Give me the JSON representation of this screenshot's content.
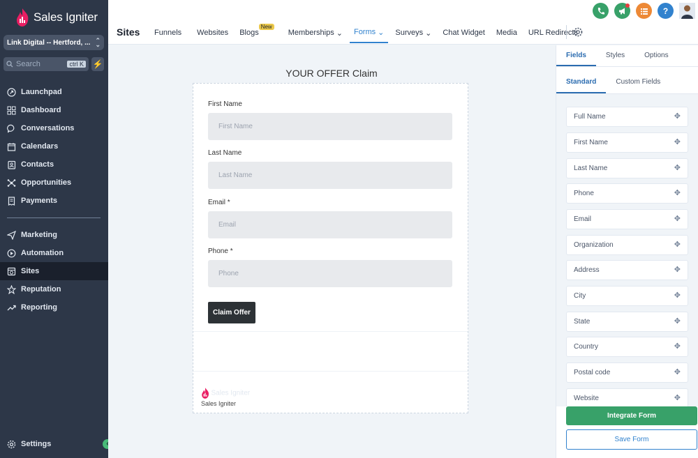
{
  "brand": {
    "name": "Sales Igniter",
    "accent": "#e91e63"
  },
  "account": {
    "name": "Link Digital -- Hertford, ..."
  },
  "search": {
    "placeholder": "Search",
    "shortcut": "ctrl K"
  },
  "sidebar": {
    "items": [
      {
        "label": "Launchpad",
        "icon": "rocket-icon"
      },
      {
        "label": "Dashboard",
        "icon": "grid-icon"
      },
      {
        "label": "Conversations",
        "icon": "chat-icon"
      },
      {
        "label": "Calendars",
        "icon": "calendar-icon"
      },
      {
        "label": "Contacts",
        "icon": "contacts-icon"
      },
      {
        "label": "Opportunities",
        "icon": "network-icon"
      },
      {
        "label": "Payments",
        "icon": "receipt-icon"
      }
    ],
    "items2": [
      {
        "label": "Marketing",
        "icon": "send-icon"
      },
      {
        "label": "Automation",
        "icon": "automation-icon"
      },
      {
        "label": "Sites",
        "icon": "globe-icon",
        "active": true
      },
      {
        "label": "Reputation",
        "icon": "star-icon"
      },
      {
        "label": "Reporting",
        "icon": "trend-icon"
      }
    ],
    "settings_label": "Settings"
  },
  "topbar": {
    "section": "Sites",
    "menu": [
      {
        "label": "Funnels"
      },
      {
        "label": "Websites"
      },
      {
        "label": "Blogs",
        "badge": "New"
      },
      {
        "label": "Memberships",
        "dropdown": true
      },
      {
        "label": "Forms",
        "dropdown": true,
        "active": true
      },
      {
        "label": "Surveys",
        "dropdown": true
      },
      {
        "label": "Chat Widget"
      },
      {
        "label": "Media"
      },
      {
        "label": "URL Redirects"
      }
    ],
    "icon_colors": {
      "phone": "#38a169",
      "megaphone": "#38a169",
      "list": "#ed8936",
      "help": "#3182ce"
    },
    "help_glyph": "?"
  },
  "form": {
    "title": "YOUR OFFER Claim",
    "fields": [
      {
        "label": "First Name",
        "placeholder": "First Name"
      },
      {
        "label": "Last Name",
        "placeholder": "Last Name"
      },
      {
        "label": "Email *",
        "placeholder": "Email"
      },
      {
        "label": "Phone *",
        "placeholder": "Phone"
      }
    ],
    "submit": "Claim Offer",
    "footer_brand": "Sales Igniter"
  },
  "panel": {
    "tabs": [
      "Fields",
      "Styles",
      "Options"
    ],
    "subtabs": [
      "Standard",
      "Custom Fields"
    ],
    "fields": [
      "Full Name",
      "First Name",
      "Last Name",
      "Phone",
      "Email",
      "Organization",
      "Address",
      "City",
      "State",
      "Country",
      "Postal code",
      "Website"
    ],
    "integrate_label": "Integrate Form",
    "save_label": "Save Form"
  }
}
